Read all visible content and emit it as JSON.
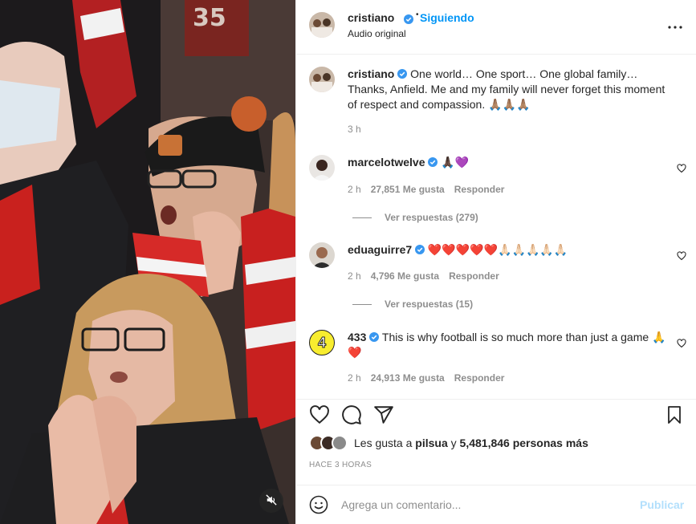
{
  "header": {
    "username": "cristiano",
    "separator": "•",
    "follow_label": "Siguiendo",
    "subtitle": "Audio original"
  },
  "caption": {
    "username": "cristiano",
    "text": "One world… One sport… One global family… Thanks, Anfield. Me and my family will never forget this moment of respect and compassion. 🙏🏽🙏🏽🙏🏽",
    "time": "3 h"
  },
  "comments": [
    {
      "username": "marcelotwelve",
      "text": "🙏🏿💜",
      "time": "2 h",
      "likes": "27,851 Me gusta",
      "reply_label": "Responder",
      "view_replies": "Ver respuestas (279)"
    },
    {
      "username": "eduaguirre7",
      "text": "❤️❤️❤️❤️❤️🙏🏻🙏🏻🙏🏻🙏🏻🙏🏻",
      "time": "2 h",
      "likes": "4,796 Me gusta",
      "reply_label": "Responder",
      "view_replies": "Ver respuestas (15)"
    },
    {
      "username": "433",
      "avatar_text": "4",
      "text": "This is why football is so much more than just a game 🙏❤️",
      "time": "2 h",
      "likes": "24,913 Me gusta",
      "reply_label": "Responder"
    }
  ],
  "likes": {
    "prefix": "Les gusta a",
    "user": "pilsua",
    "connector": "y",
    "count": "5,481,846 personas más"
  },
  "timestamp": "Hace 3 horas",
  "composer": {
    "placeholder": "Agrega un comentario...",
    "post_label": "Publicar"
  },
  "colors": {
    "accent": "#0095f6",
    "accent_disabled": "#b2dffc",
    "text": "#262626",
    "secondary": "#8e8e8e",
    "border": "#efefef"
  },
  "icons": [
    "mute-icon",
    "verified-icon",
    "more-icon",
    "heart-icon",
    "comment-icon",
    "share-icon",
    "save-icon",
    "emoji-icon"
  ]
}
